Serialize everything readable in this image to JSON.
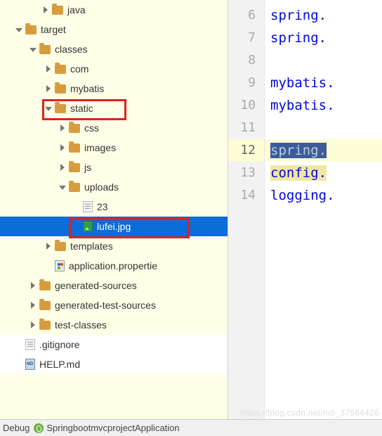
{
  "tree": {
    "java": "java",
    "target": "target",
    "classes": "classes",
    "com": "com",
    "mybatis": "mybatis",
    "static": "static",
    "css": "css",
    "images": "images",
    "js": "js",
    "uploads": "uploads",
    "file23": "23",
    "lufei": "lufei.jpg",
    "templates": "templates",
    "appprops": "application.propertie",
    "gensources": "generated-sources",
    "gentestsources": "generated-test-sources",
    "testclasses": "test-classes",
    "gitignore": ".gitignore",
    "helpmd": "HELP.md"
  },
  "editor": {
    "l6": "spring.",
    "l7": "spring.",
    "l9": "mybatis.",
    "l10": "mybatis.",
    "l12a": "spring.",
    "l13": "config.",
    "l14": "logging."
  },
  "gutter": [
    "6",
    "7",
    "8",
    "9",
    "10",
    "11",
    "12",
    "13",
    "14"
  ],
  "status": {
    "debug": "Debug",
    "app": "SpringbootmvcprojectApplication"
  },
  "watermark": "https://blog.csdn.net/m0_37564426"
}
